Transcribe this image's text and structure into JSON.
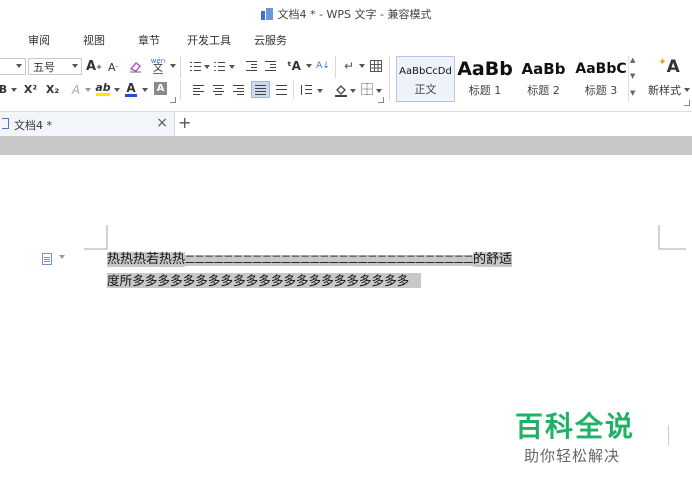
{
  "window": {
    "title": "文档4 * - WPS 文字 - 兼容模式"
  },
  "menu": {
    "tabs": [
      "审阅",
      "视图",
      "章节",
      "开发工具",
      "云服务"
    ]
  },
  "toolbar": {
    "font_size": "五号",
    "grow_font": "A",
    "shrink_font": "A",
    "superscript": "X²",
    "subscript": "X₂",
    "font_color_letter": "A",
    "highlight_letter": "ab",
    "char_shading": "A",
    "phonetic": "wén",
    "cut_bold_left": "B"
  },
  "styles": {
    "items": [
      {
        "preview": "AaBbCcDd",
        "label": "正文",
        "selected": true
      },
      {
        "preview": "AaBb",
        "label": "标题 1",
        "selected": false
      },
      {
        "preview": "AaBb",
        "label": "标题 2",
        "selected": false
      },
      {
        "preview": "AaBbC",
        "label": "标题 3",
        "selected": false
      }
    ],
    "new_style_label": "新样式"
  },
  "tabs": {
    "doc_title": "文档4 *",
    "close_glyph": "×",
    "new_tab_glyph": "+"
  },
  "document": {
    "line1_prefix": "热热热若热热",
    "line1_dashes": "二二二二二二二二二二二二二二二二二二二二二二二二二二二二二二",
    "line1_suffix": "的舒适",
    "line2": "度所多多多多多多多多多多多多多多多多多多多多多多"
  },
  "watermark": {
    "title": "百科全说",
    "subtitle": "助你轻松解决"
  },
  "colors": {
    "accent": "#3b73c7",
    "watermark_green": "#1db266",
    "selection": "#c8c8c8"
  }
}
